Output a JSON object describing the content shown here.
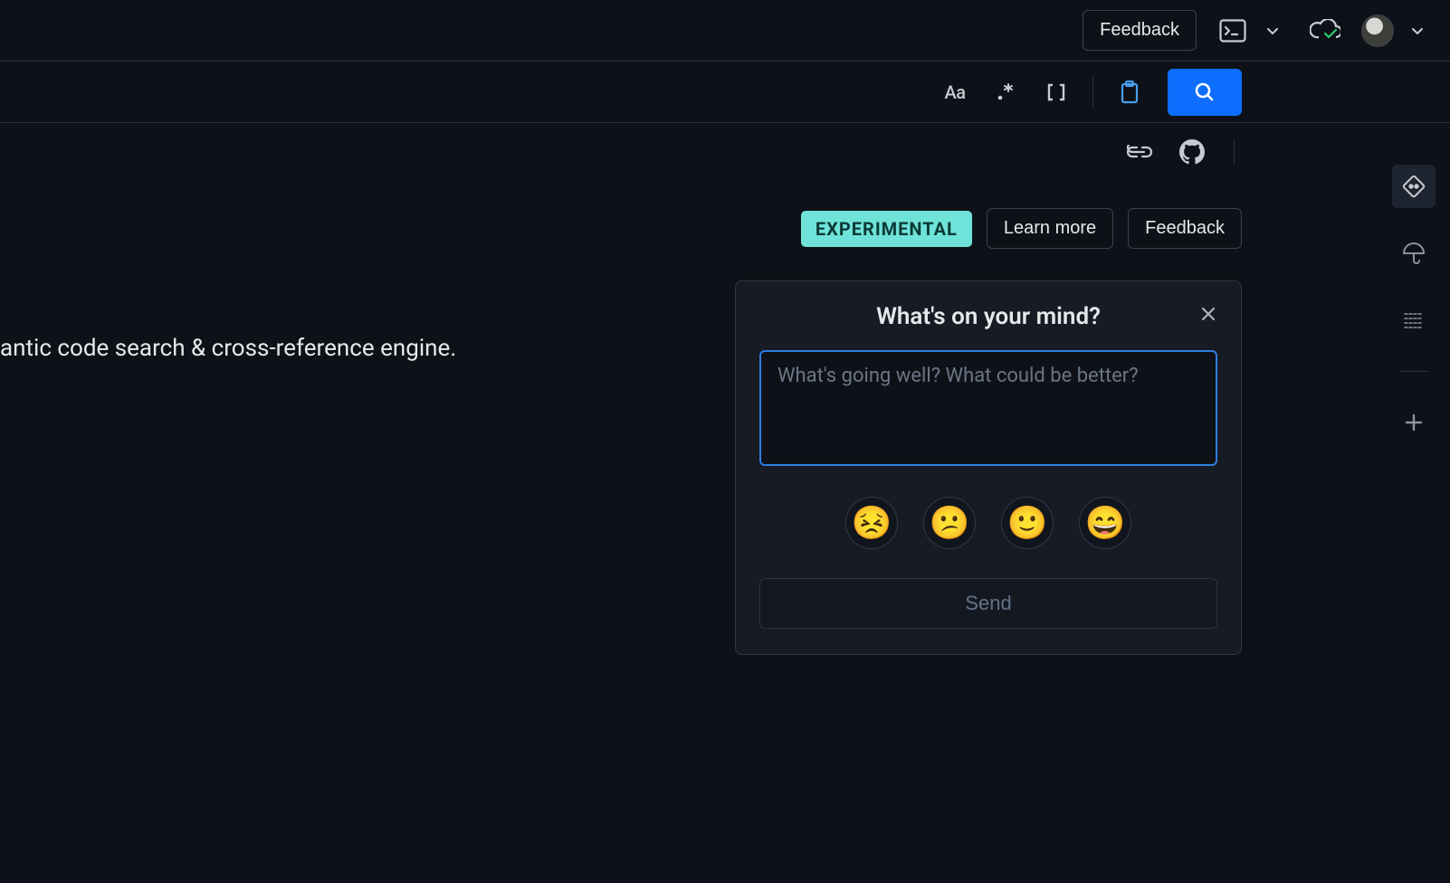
{
  "topbar": {
    "feedback_label": "Feedback"
  },
  "searchbar": {
    "case_label": "Aa"
  },
  "hero": {
    "badge": "EXPERIMENTAL",
    "learn_more": "Learn more",
    "feedback": "Feedback",
    "tagline": "antic code search & cross-reference engine."
  },
  "popover": {
    "title": "What's on your mind?",
    "placeholder": "What's going well? What could be better?",
    "send": "Send",
    "emoji": {
      "very_sad": "😣",
      "confused": "😕",
      "happy": "🙂",
      "very_happy": "😄"
    }
  }
}
